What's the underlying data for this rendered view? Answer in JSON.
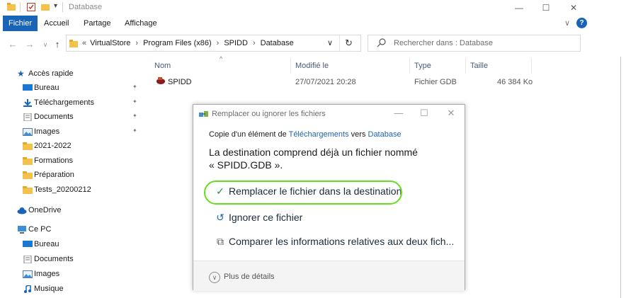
{
  "window": {
    "title": "Database",
    "controls": [
      "—",
      "☐",
      "✕"
    ]
  },
  "ribbon": {
    "tabs": [
      "Fichier",
      "Accueil",
      "Partage",
      "Affichage"
    ],
    "help_icon": "?"
  },
  "address": {
    "crumbs": [
      "VirtualStore",
      "Program Files (x86)",
      "SPIDD",
      "Database"
    ],
    "search_placeholder": "Rechercher dans : Database"
  },
  "sidebar": {
    "quick_access": "Accès rapide",
    "items": [
      {
        "label": "Bureau",
        "icon": "desktop-icon",
        "pinned": true
      },
      {
        "label": "Téléchargements",
        "icon": "download-icon",
        "pinned": true
      },
      {
        "label": "Documents",
        "icon": "documents-icon",
        "pinned": true
      },
      {
        "label": "Images",
        "icon": "images-icon",
        "pinned": true
      },
      {
        "label": "2021-2022",
        "icon": "folder-icon",
        "pinned": false
      },
      {
        "label": "Formations",
        "icon": "folder-icon",
        "pinned": false
      },
      {
        "label": "Préparation",
        "icon": "folder-icon",
        "pinned": false
      },
      {
        "label": "Tests_20200212",
        "icon": "folder-icon",
        "pinned": false
      }
    ],
    "onedrive": "OneDrive",
    "thispc": "Ce PC",
    "pc_items": [
      {
        "label": "Bureau",
        "icon": "desktop-icon"
      },
      {
        "label": "Documents",
        "icon": "documents-icon"
      },
      {
        "label": "Images",
        "icon": "images-icon"
      },
      {
        "label": "Musique",
        "icon": "music-icon"
      }
    ]
  },
  "file_list": {
    "headers": {
      "name": "Nom",
      "modified": "Modifié le",
      "type": "Type",
      "size": "Taille"
    },
    "rows": [
      {
        "name": "SPIDD",
        "modified": "27/07/2021 20:28",
        "type": "Fichier GDB",
        "size": "46 384 Ko"
      }
    ]
  },
  "dialog": {
    "title": "Remplacer ou ignorer les fichiers",
    "copy_prefix": "Copie d'un élément de ",
    "copy_source": "Téléchargements",
    "copy_middle": " vers ",
    "copy_dest": "Database",
    "message_line1": "La destination comprend déjà un fichier nommé",
    "message_line2": "« SPIDD.GDB ».",
    "option_replace": "Remplacer le fichier dans la destination",
    "option_skip": "Ignorer ce fichier",
    "option_compare": "Comparer les informations relatives aux deux fich...",
    "more_details": "Plus de détails"
  },
  "colors": {
    "accent": "#1a64b8",
    "highlight": "#66dd22",
    "folder": "#f2c24a"
  }
}
